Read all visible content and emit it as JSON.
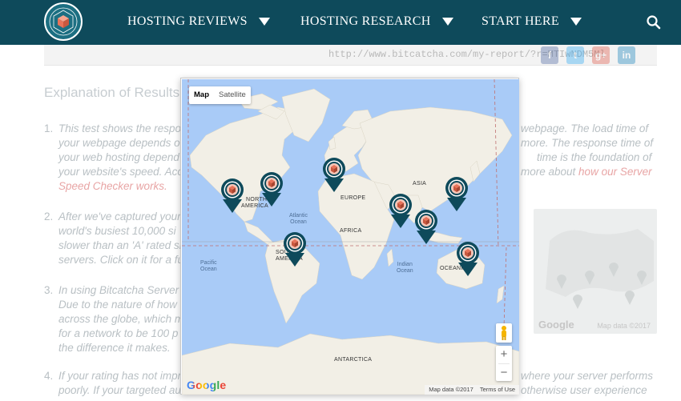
{
  "header": {
    "nav": [
      {
        "label": "HOSTING REVIEWS"
      },
      {
        "label": "HOSTING RESEARCH"
      },
      {
        "label": "START HERE"
      }
    ],
    "colors": {
      "bar": "#0e4a5b",
      "text": "#ffffff"
    }
  },
  "page": {
    "report_url": "http://www.bitcatcha.com/my-report/?r=MTIwNDM5Ml",
    "share_buttons": [
      {
        "label": "f",
        "icon": "facebook-icon",
        "color": "#3b5998"
      },
      {
        "label": "t",
        "icon": "twitter-icon",
        "color": "#1da1f2"
      },
      {
        "label": "g+",
        "icon": "google-plus-icon",
        "color": "#dd4b39"
      },
      {
        "label": "in",
        "icon": "linkedin-icon",
        "color": "#0077b5"
      }
    ],
    "explanation_title": "Explanation of Results",
    "paragraphs": [
      {
        "num": "1.",
        "lines": [
          "This test shows the respo",
          "your webpage depends o",
          "your web hosting depend",
          "your website's speed. Acc"
        ],
        "right_lines": [
          "webpage. The load time of",
          "more. The response time of",
          "time is the foundation of",
          "more about "
        ],
        "link": "how our Server",
        "link2": "Speed Checker works."
      },
      {
        "num": "2.",
        "lines": [
          "After we've captured your",
          "world's busiest 10,000 si",
          "slower than an 'A' rated si",
          "servers. Click on it for a fu"
        ]
      },
      {
        "num": "3.",
        "lines": [
          "In using Bitcatcha Server",
          "Due to the nature of how",
          "across the globe, which m",
          "for a network to be 100 p",
          "the difference it makes."
        ]
      },
      {
        "num": "4.",
        "lines": [
          "If your rating has not impr",
          "poorly. If your targeted au"
        ],
        "right_lines": [
          "where your server performs",
          "otherwise user experience"
        ]
      }
    ],
    "side_image_caption": "Map data ©2017"
  },
  "map": {
    "type_controls": [
      {
        "label": "Map",
        "active": true
      },
      {
        "label": "Satellite",
        "active": false
      }
    ],
    "zoom_in": "+",
    "zoom_out": "−",
    "google_logo": "Google",
    "attribution": {
      "data": "Map data ©2017",
      "terms": "Terms of Use"
    },
    "labels": {
      "north_america": [
        "NORTH",
        "AMERICA"
      ],
      "south_america": [
        "SOUTH",
        "AMERICA"
      ],
      "europe": "EUROPE",
      "asia": "ASIA",
      "africa": "AFRICA",
      "oceania": "OCEANIA",
      "antarctica": "ANTARCTICA",
      "atlantic": [
        "Atlantic",
        "Ocean"
      ],
      "pacific": [
        "Pacific",
        "Ocean"
      ],
      "indian": [
        "Indian",
        "Ocean"
      ]
    },
    "markers": [
      {
        "name": "marker-us-west"
      },
      {
        "name": "marker-us-east"
      },
      {
        "name": "marker-europe"
      },
      {
        "name": "marker-india"
      },
      {
        "name": "marker-singapore"
      },
      {
        "name": "marker-japan"
      },
      {
        "name": "marker-brazil"
      },
      {
        "name": "marker-australia"
      }
    ],
    "colors": {
      "water": "#a9cbf7",
      "land": "#f2efe6",
      "marker": "#0e4a5b",
      "marker_inner": "#e8735a"
    }
  }
}
